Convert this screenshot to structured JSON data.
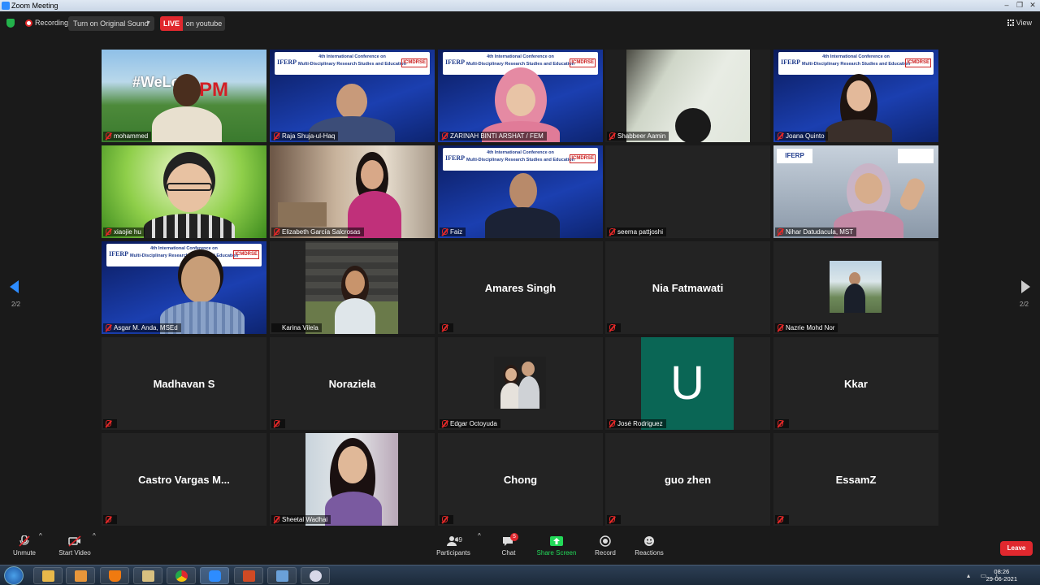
{
  "window": {
    "title": "Zoom Meeting"
  },
  "meeting_bar": {
    "recording_label": "Recording",
    "sound_button": "Turn on Original Sound",
    "live_badge": "LIVE",
    "live_destination": "on youtube",
    "view_label": "View"
  },
  "pagination": {
    "left": "2/2",
    "right": "2/2"
  },
  "banner": {
    "line1": "4th International Conference on",
    "line2": "Multi-Disciplinary Research Studies and Education",
    "logo_left": "IFERP",
    "logo_right": "ICMDRSE"
  },
  "participants": [
    {
      "name": "mohammed",
      "video": true
    },
    {
      "name": "Raja Shuja-ul-Haq",
      "video": true
    },
    {
      "name": "ZARINAH BINTI ARSHAT / FEM",
      "video": true
    },
    {
      "name": "Shabbeer Aamin",
      "video": true
    },
    {
      "name": "Joana Quinto",
      "video": true
    },
    {
      "name": "xiaojie hu",
      "video": true
    },
    {
      "name": "Elizabeth García Salcrosas",
      "video": true
    },
    {
      "name": "Faiz",
      "video": true
    },
    {
      "name": "seema pattjoshi",
      "video": false
    },
    {
      "name": "Nihar Datudacula, MST",
      "video": true
    },
    {
      "name": "Asgar M. Anda, MSEd",
      "video": true
    },
    {
      "name": "Karina Vilela",
      "video": true
    },
    {
      "name": "Amares Singh",
      "video": false
    },
    {
      "name": "Nia Fatmawati",
      "video": false
    },
    {
      "name": "Nazrie Mohd Nor",
      "video": true
    },
    {
      "name": "Madhavan S",
      "video": false
    },
    {
      "name": "Noraziela",
      "video": false
    },
    {
      "name": "Edgar Octoyuda",
      "video": true
    },
    {
      "name": "José Rodriguez",
      "video": true,
      "initial": "U"
    },
    {
      "name": "Kkar",
      "video": false
    },
    {
      "name": "Castro Vargas M...",
      "video": false
    },
    {
      "name": "Sheetal Wadhai",
      "video": true
    },
    {
      "name": "Chong",
      "video": false
    },
    {
      "name": "guo zhen",
      "video": false
    },
    {
      "name": "EssamZ",
      "video": false
    }
  ],
  "toolbar": {
    "unmute": "Unmute",
    "start_video": "Start Video",
    "participants": "Participants",
    "participant_count": "49",
    "chat": "Chat",
    "chat_badge": "5",
    "share_screen": "Share Screen",
    "record": "Record",
    "reactions": "Reactions",
    "leave": "Leave"
  },
  "taskbar": {
    "time": "08:26",
    "date": "29-06-2021"
  },
  "colors": {
    "accent_blue": "#2d8cff",
    "live_red": "#e0282e",
    "share_green": "#23d959",
    "avatar_teal": "#0a6655"
  }
}
